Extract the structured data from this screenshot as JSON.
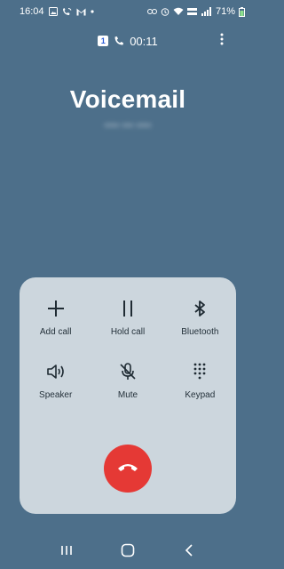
{
  "status_bar": {
    "time": "16:04",
    "battery_percent": "71%",
    "icons_left": [
      "gallery-icon",
      "wifi-calling-icon",
      "gmail-icon",
      "dot-icon"
    ],
    "icons_right": [
      "link-icon",
      "alarm-icon",
      "wifi-icon",
      "volte-icon",
      "signal-icon",
      "battery-icon"
    ]
  },
  "call": {
    "sim_label": "1",
    "duration": "00:11",
    "caller_name": "Voicemail",
    "caller_number_redacted": "•••• ••• ••••"
  },
  "controls": [
    {
      "key": "add_call",
      "label": "Add call",
      "icon": "add-call-icon"
    },
    {
      "key": "hold_call",
      "label": "Hold call",
      "icon": "pause-icon"
    },
    {
      "key": "bluetooth",
      "label": "Bluetooth",
      "icon": "bluetooth-icon"
    },
    {
      "key": "speaker",
      "label": "Speaker",
      "icon": "speaker-icon"
    },
    {
      "key": "mute",
      "label": "Mute",
      "icon": "mic-off-icon"
    },
    {
      "key": "keypad",
      "label": "Keypad",
      "icon": "keypad-icon"
    }
  ],
  "end_call": {
    "icon": "end-call-icon",
    "color": "#e53935"
  },
  "nav": {
    "items": [
      "recent-apps-icon",
      "home-icon",
      "back-icon"
    ]
  },
  "colors": {
    "background": "#4d6f8a",
    "panel": "#ccd6dd",
    "end_call": "#e53935"
  }
}
